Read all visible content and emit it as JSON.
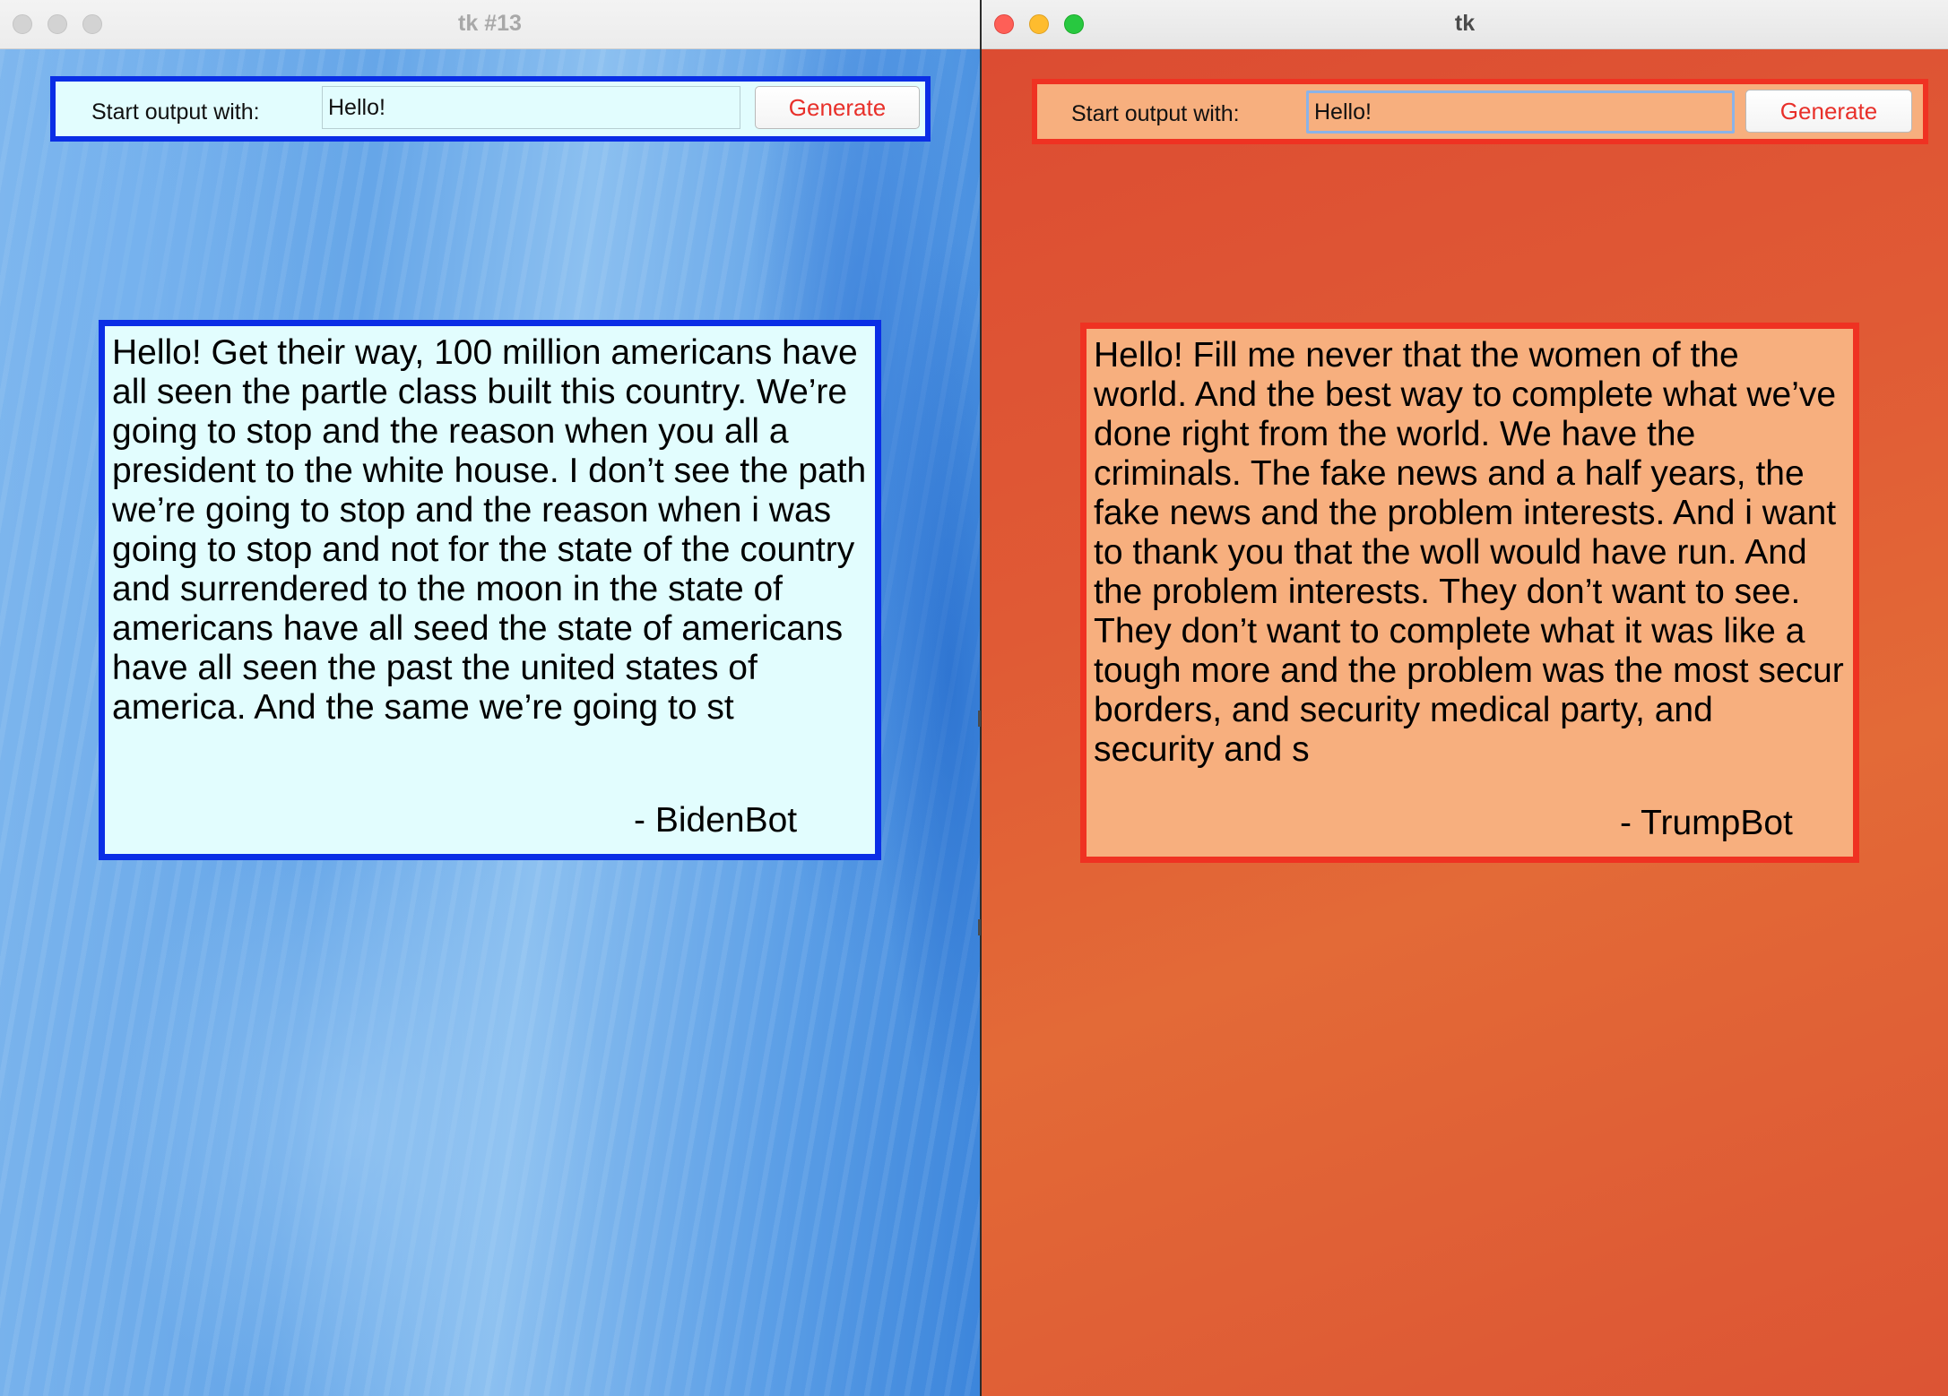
{
  "windows": [
    {
      "title": "tk #13",
      "prompt_label": "Start output with:",
      "prompt_value": "Hello!",
      "generate_label": "Generate",
      "output_text": "Hello! Get their way, 100 million americans have all seen the partle class built this country. We’re going to stop and the reason when you all a president to the white house. I don’t see the path we’re going to stop and the reason when i was going to stop and not for the state of the country and surrendered to the moon in the state of americans have all seed the state of americans have all seen the past the united states of america. And the same we’re going to st",
      "signature": "- BidenBot",
      "accent_color": "#0a2ee6",
      "panel_color": "#e2fdfe"
    },
    {
      "title": "tk",
      "prompt_label": "Start output with:",
      "prompt_value": "Hello! ",
      "generate_label": "Generate",
      "output_text": "Hello! Fill me never that the women of the\nworld. And the best way to complete what we’ve\ndone right from the world. We have the\ncriminals. The fake news and a half years, the\nfake news and the problem interests. And i want\nto thank you that the woll would have run. And\nthe problem interests. They don’t want to see.\nThey don’t want to complete what it was like a\ntough more and the problem was the most secur\nborders, and security medical party, and\nsecurity and s",
      "signature": "- TrumpBot",
      "accent_color": "#ef3222",
      "panel_color": "#f7af7e"
    }
  ]
}
